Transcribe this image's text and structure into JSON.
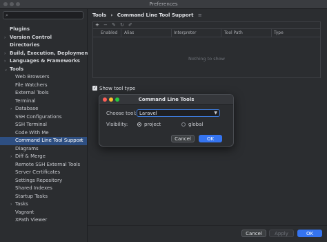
{
  "window": {
    "title": "Preferences"
  },
  "sidebar": {
    "search_placeholder": "",
    "items": [
      {
        "label": "Plugins",
        "level": 0,
        "arrow": ""
      },
      {
        "label": "Version Control",
        "level": 0,
        "arrow": "›"
      },
      {
        "label": "Directories",
        "level": 0,
        "arrow": ""
      },
      {
        "label": "Build, Execution, Deployment",
        "level": 0,
        "arrow": "›"
      },
      {
        "label": "Languages & Frameworks",
        "level": 0,
        "arrow": "›"
      },
      {
        "label": "Tools",
        "level": 0,
        "arrow": "⌄"
      },
      {
        "label": "Web Browsers",
        "level": 1,
        "arrow": ""
      },
      {
        "label": "File Watchers",
        "level": 1,
        "arrow": ""
      },
      {
        "label": "External Tools",
        "level": 1,
        "arrow": ""
      },
      {
        "label": "Terminal",
        "level": 1,
        "arrow": ""
      },
      {
        "label": "Database",
        "level": 1,
        "arrow": "›"
      },
      {
        "label": "SSH Configurations",
        "level": 1,
        "arrow": ""
      },
      {
        "label": "SSH Terminal",
        "level": 1,
        "arrow": ""
      },
      {
        "label": "Code With Me",
        "level": 1,
        "arrow": ""
      },
      {
        "label": "Command Line Tool Support",
        "level": 1,
        "arrow": "",
        "selected": true
      },
      {
        "label": "Diagrams",
        "level": 1,
        "arrow": ""
      },
      {
        "label": "Diff & Merge",
        "level": 1,
        "arrow": "›"
      },
      {
        "label": "Remote SSH External Tools",
        "level": 1,
        "arrow": ""
      },
      {
        "label": "Server Certificates",
        "level": 1,
        "arrow": ""
      },
      {
        "label": "Settings Repository",
        "level": 1,
        "arrow": ""
      },
      {
        "label": "Shared Indexes",
        "level": 1,
        "arrow": ""
      },
      {
        "label": "Startup Tasks",
        "level": 1,
        "arrow": ""
      },
      {
        "label": "Tasks",
        "level": 1,
        "arrow": "›"
      },
      {
        "label": "Vagrant",
        "level": 1,
        "arrow": ""
      },
      {
        "label": "XPath Viewer",
        "level": 1,
        "arrow": ""
      }
    ]
  },
  "main": {
    "breadcrumb": {
      "root": "Tools",
      "sep": "›",
      "current": "Command Line Tool Support"
    },
    "table": {
      "columns": [
        "Enabled",
        "Alias",
        "Interpreter",
        "Tool Path",
        "Type"
      ],
      "empty_text": "Nothing to show"
    },
    "show_tool_type": {
      "label": "Show tool type",
      "checked": true
    }
  },
  "dialog": {
    "title": "Command Line Tools",
    "choose_tool_label": "Choose tool:",
    "choose_tool_value": "Laravel",
    "visibility_label": "Visibility:",
    "option_project": "project",
    "option_global": "global",
    "selected_visibility": "project",
    "cancel_label": "Cancel",
    "ok_label": "OK"
  },
  "footer": {
    "cancel_label": "Cancel",
    "apply_label": "Apply",
    "ok_label": "OK"
  },
  "colors": {
    "accent": "#3574f0",
    "selection": "#2e4f82",
    "close_dot": "#ff5f57",
    "minimize_dot": "#febc2e",
    "zoom_dot": "#28c840"
  }
}
